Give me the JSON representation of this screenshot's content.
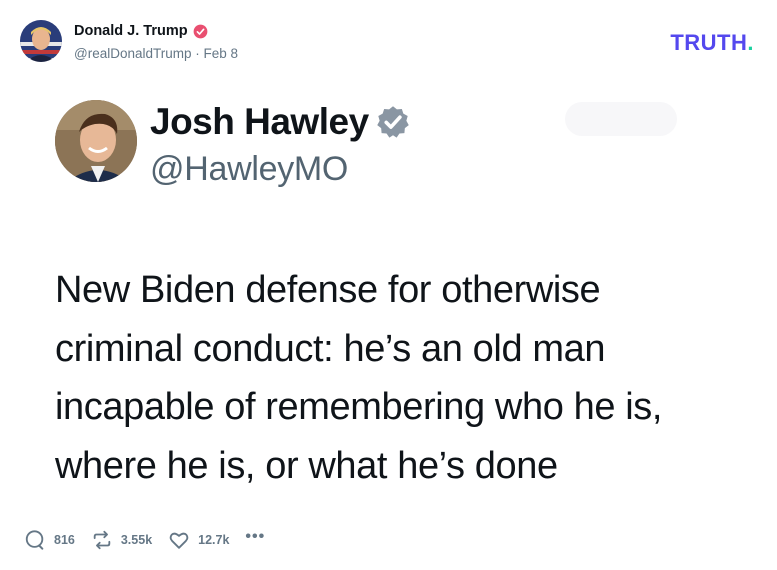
{
  "post": {
    "author_name": "Donald J. Trump",
    "author_handle": "@realDonaldTrump",
    "date": "Feb 8",
    "brand": "TRUTH",
    "brand_dot": "."
  },
  "quoted": {
    "name": "Josh Hawley",
    "handle": "@HawleyMO",
    "text": "New Biden defense for otherwise criminal conduct: he’s an old man incapable of remembering who he is, where he is, or what he’s done"
  },
  "actions": {
    "replies": "816",
    "retruths": "3.55k",
    "likes": "12.7k",
    "more": "•••"
  },
  "colors": {
    "brand": "#5448ee",
    "brand_dot": "#1cd1a1",
    "verified_pink": "#e94f70",
    "verified_grey": "#8a96a3",
    "meta_grey": "#657786"
  }
}
